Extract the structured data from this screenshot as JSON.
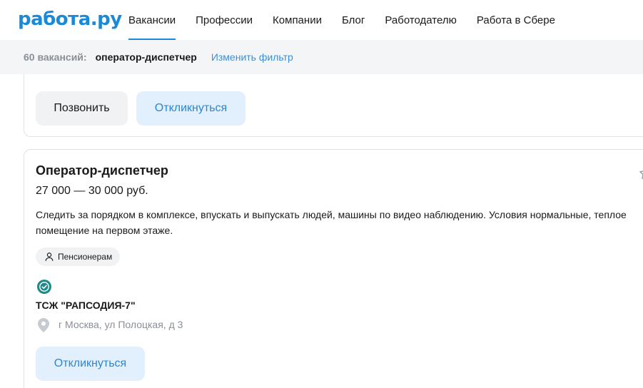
{
  "header": {
    "logo": "работа.ру",
    "nav": [
      {
        "label": "Вакансии",
        "active": true
      },
      {
        "label": "Профессии",
        "active": false
      },
      {
        "label": "Компании",
        "active": false
      },
      {
        "label": "Блог",
        "active": false
      },
      {
        "label": "Работодателю",
        "active": false
      },
      {
        "label": "Работа в Сбере",
        "active": false
      }
    ]
  },
  "filter": {
    "count": "60 вакансий:",
    "query": "оператор-диспетчер",
    "change": "Изменить фильтр"
  },
  "card_prev": {
    "call_label": "Позвонить",
    "respond_label": "Откликнуться"
  },
  "card": {
    "title": "Оператор-диспетчер",
    "salary": "27 000 — 30 000 руб.",
    "description": "Следить за порядком в комплексе, впускать и выпускать людей, машины по видео наблюдению. Условия нормальные, теплое помещение на первом этаже.",
    "tag": "Пенсионерам",
    "company": "ТСЖ \"РАПСОДИЯ-7\"",
    "address": "г Москва, ул Полоцкая, д 3",
    "respond_label": "Откликнуться"
  },
  "icons": {
    "verified": "verified-check-icon",
    "tag": "person-icon",
    "location": "location-pin-icon",
    "favorite": "star-icon"
  },
  "colors": {
    "brand": "#1a8ad8",
    "verified": "#1f8a8a",
    "button_blue_bg": "#e1f0fc",
    "button_blue_text": "#2d86d1"
  }
}
